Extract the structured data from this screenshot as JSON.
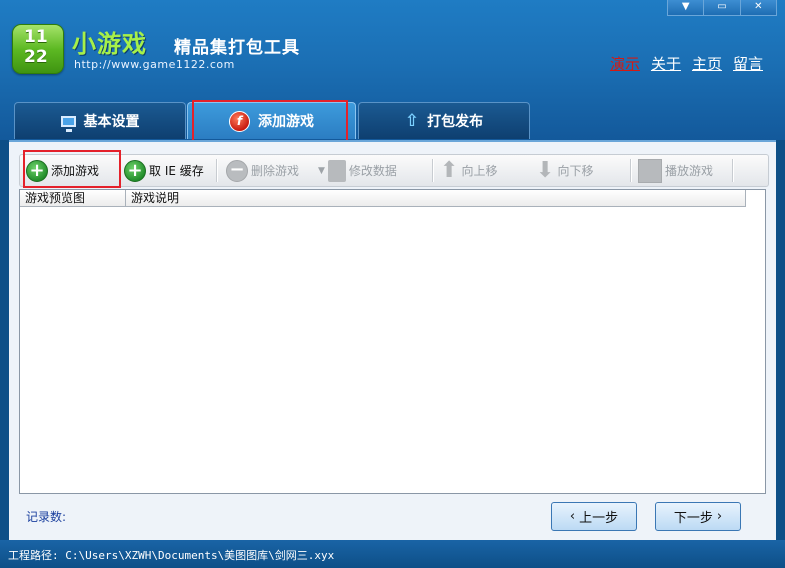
{
  "window": {
    "min_label": "▼",
    "restore_label": "▭",
    "close_label": "✕"
  },
  "header": {
    "logo_top": "11",
    "logo_bottom": "22",
    "brand_name": "小游戏",
    "subtitle": "精品集打包工具",
    "url": "http://www.game1122.com",
    "links": {
      "demo": "演示",
      "about": "关于",
      "home": "主页",
      "message": "留言"
    }
  },
  "tabs": [
    {
      "label": "基本设置",
      "icon": "monitor-icon",
      "active": false
    },
    {
      "label": "添加游戏",
      "icon": "flash-icon",
      "active": true
    },
    {
      "label": "打包发布",
      "icon": "up-arrow-icon",
      "active": false
    }
  ],
  "toolbar": {
    "add_game": "添加游戏",
    "take_ie_cache": "取 IE 缓存",
    "delete_game": "删除游戏",
    "edit_data": "修改数据",
    "move_up": "向上移",
    "move_down": "向下移",
    "play_game": "播放游戏"
  },
  "grid": {
    "columns": [
      "游戏预览图",
      "游戏说明"
    ],
    "rows": []
  },
  "footer_bar": {
    "record_label": "记录数:",
    "prev_label": "上一步",
    "next_label": "下一步"
  },
  "status": {
    "project_path": "工程路径: C:\\Users\\XZWH\\Documents\\美图图库\\剑网三.xyx"
  },
  "colors": {
    "header_bg": "#1b6fb4",
    "brand_green": "#a6f04a",
    "highlight_red": "#e4212a",
    "demo_link": "#d41a12"
  }
}
